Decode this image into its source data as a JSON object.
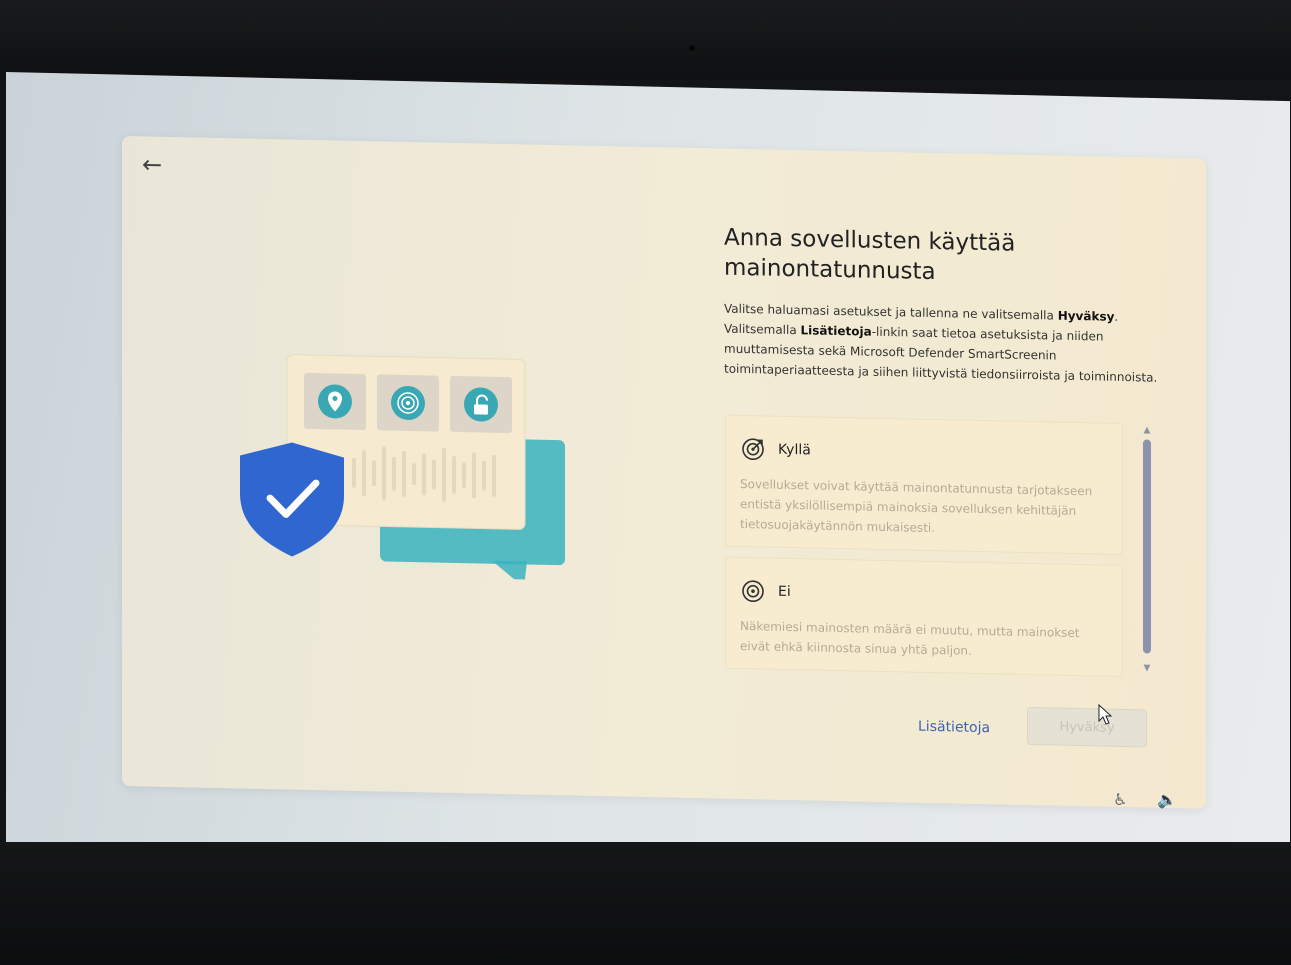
{
  "page": {
    "title_line1": "Anna sovellusten käyttää",
    "title_line2": "mainontatunnusta",
    "description": {
      "part1": "Valitse haluamasi asetukset ja tallenna ne valitsemalla ",
      "accept_bold": "Hyväksy",
      "part2": ". Valitsemalla ",
      "link_bold": "Lisätietoja",
      "part3": "-linkin saat tietoa asetuksista ja niiden muuttamisesta sekä Microsoft Defender SmartScreenin toimintaperiaatteesta ja siihen liittyvistä tiedonsiirroista ja toiminnoista."
    }
  },
  "options": [
    {
      "icon": "target-icon",
      "title": "Kyllä",
      "description": "Sovellukset voivat käyttää mainontatunnusta tarjotakseen entistä yksilöllisempiä mainoksia sovelluksen kehittäjän tietosuojakäytännön mukaisesti."
    },
    {
      "icon": "target-off-icon",
      "title": "Ei",
      "description": "Näkemiesi mainosten määrä ei muutu, mutta mainokset eivät ehkä kiinnosta sinua yhtä paljon."
    }
  ],
  "buttons": {
    "learn_more": "Lisätietoja",
    "accept": "Hyväksy"
  },
  "icons": {
    "back": "back-arrow-icon",
    "accessibility": "accessibility-icon",
    "volume": "volume-icon"
  },
  "colors": {
    "shield": "#2f66d0",
    "accent_teal": "#3ab3c0",
    "link": "#3c64b4"
  }
}
